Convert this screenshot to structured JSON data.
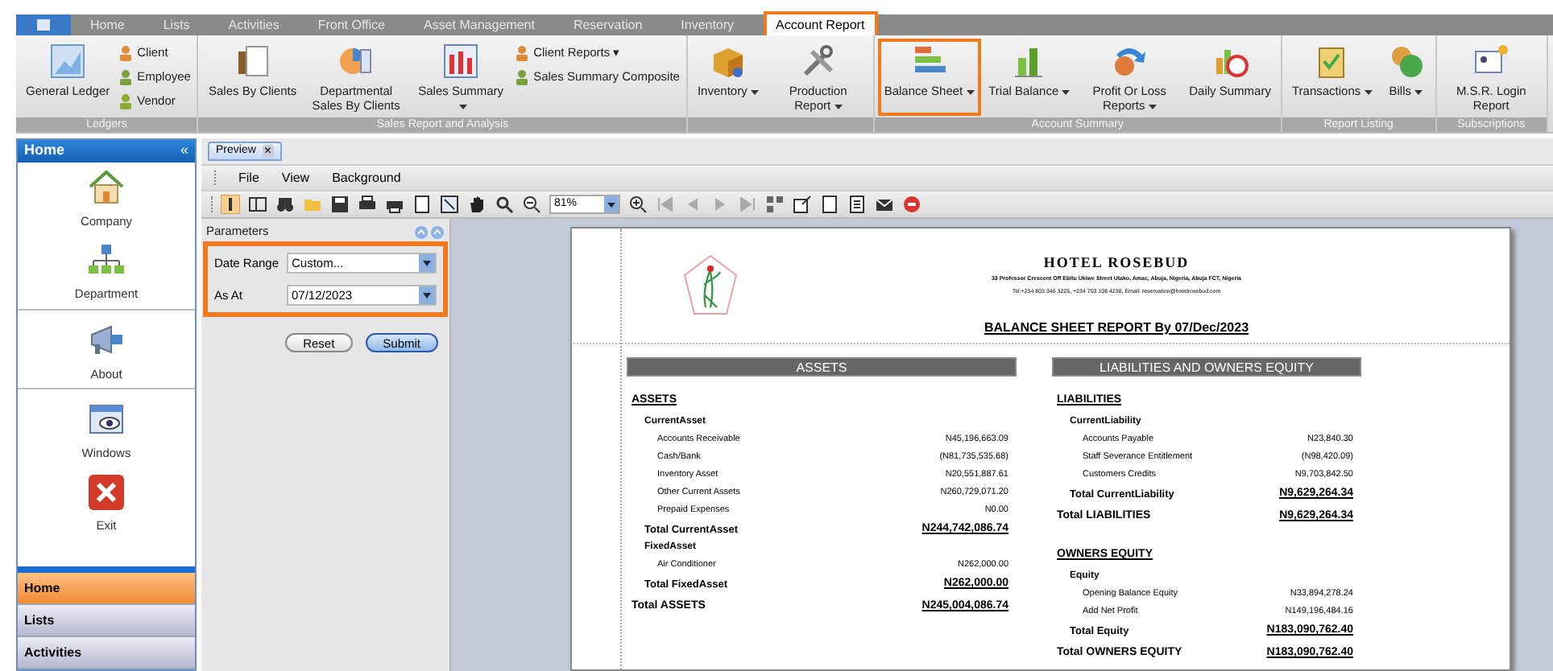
{
  "menu_tabs": [
    {
      "label": "Home",
      "selected": false
    },
    {
      "label": "Lists",
      "selected": false
    },
    {
      "label": "Activities",
      "selected": false
    },
    {
      "label": "Front Office",
      "selected": false
    },
    {
      "label": "Asset Management",
      "selected": false
    },
    {
      "label": "Reservation",
      "selected": false
    },
    {
      "label": "Inventory",
      "selected": false
    },
    {
      "label": "Account Report",
      "selected": true
    }
  ],
  "ribbon_groups": [
    {
      "label": "Ledgers",
      "buttons": [
        {
          "kind": "large",
          "label": "General Ledger",
          "has_menu": false,
          "highlighted": false
        },
        {
          "kind": "stack",
          "items": [
            "Client",
            "Employee",
            "Vendor"
          ]
        }
      ]
    },
    {
      "label": "Sales Report and Analysis",
      "buttons": [
        {
          "kind": "large",
          "label": "Sales By Clients",
          "has_menu": false,
          "highlighted": false
        },
        {
          "kind": "large",
          "label": "Departmental Sales By Clients",
          "has_menu": false,
          "highlighted": false
        },
        {
          "kind": "large",
          "label": "Sales Summary",
          "has_menu": true,
          "highlighted": false
        },
        {
          "kind": "stack",
          "items": [
            "Client Reports ▾",
            "Sales Summary Composite"
          ]
        }
      ]
    },
    {
      "buttons": [
        {
          "kind": "large",
          "label": "Inventory",
          "has_menu": true,
          "highlighted": false
        },
        {
          "kind": "large",
          "label": "Production Report",
          "has_menu": true,
          "highlighted": false
        }
      ]
    },
    {
      "label": "Account Summary",
      "buttons": [
        {
          "kind": "large",
          "label": "Balance Sheet",
          "has_menu": true,
          "highlighted": true
        },
        {
          "kind": "large",
          "label": "Trial Balance",
          "has_menu": true,
          "highlighted": false
        },
        {
          "kind": "large",
          "label": "Profit Or Loss Reports",
          "has_menu": true,
          "highlighted": false
        },
        {
          "kind": "large",
          "label": "Daily Summary",
          "has_menu": false,
          "highlighted": false
        }
      ]
    },
    {
      "label": "Report Listing",
      "buttons": [
        {
          "kind": "large",
          "label": "Transactions",
          "has_menu": true,
          "highlighted": false
        },
        {
          "kind": "large",
          "label": "Bills",
          "has_menu": true,
          "highlighted": false
        }
      ]
    },
    {
      "label": "Subscriptions",
      "buttons": [
        {
          "kind": "large",
          "label": "M.S.R. Login Report",
          "has_menu": false,
          "highlighted": false
        }
      ]
    }
  ],
  "sidebar": {
    "title": "Home",
    "collapse": "«",
    "items": [
      "Company",
      "Department",
      "About",
      "Windows",
      "Exit"
    ],
    "nav": [
      {
        "label": "Home",
        "selected": true
      },
      {
        "label": "Lists",
        "selected": false
      },
      {
        "label": "Activities",
        "selected": false
      }
    ]
  },
  "document_tab": {
    "label": "Preview",
    "close": "×"
  },
  "menu": [
    "File",
    "View",
    "Background"
  ],
  "zoom": "81%",
  "parameters": {
    "title": "Parameters",
    "highlighted": true,
    "fields": [
      {
        "label": "Date Range",
        "value": "Custom..."
      },
      {
        "label": "As At",
        "value": "07/12/2023"
      }
    ],
    "buttons": [
      {
        "label": "Reset",
        "primary": false
      },
      {
        "label": "Submit",
        "primary": true
      }
    ]
  },
  "report": {
    "hotel_name": "HOTEL ROSEBUD",
    "address": "33 Professor Crescent Off Ebitu Ukiwe Street Utako, Amac, Abuja, Nigeria, Abuja FCT, Nigeria",
    "contact": "Tel:+234 803 346 3225, +234 703 108 4238, Email: reservation@hotelrosebud.com",
    "title": "BALANCE SHEET REPORT By 07/Dec/2023",
    "columns": [
      {
        "header": "ASSETS",
        "blocks": [
          {
            "title": "ASSETS",
            "groups": [
              {
                "name": "CurrentAsset",
                "items": [
                  {
                    "label": "Accounts Receivable",
                    "value": "N45,196,663.09"
                  },
                  {
                    "label": "Cash/Bank",
                    "value": "(N81,735,535.68)"
                  },
                  {
                    "label": "Inventory Asset",
                    "value": "N20,551,887.61"
                  },
                  {
                    "label": "Other Current Assets",
                    "value": "N260,729,071.20"
                  },
                  {
                    "label": "Prepaid Expenses",
                    "value": "N0.00"
                  }
                ],
                "total": {
                  "label": "Total CurrentAsset",
                  "value": "N244,742,086.74"
                }
              },
              {
                "name": "FixedAsset",
                "items": [
                  {
                    "label": "Air Conditioner",
                    "value": "N262,000.00"
                  }
                ],
                "total": {
                  "label": "Total FixedAsset",
                  "value": "N262,000.00"
                }
              }
            ],
            "total": {
              "label": "Total ASSETS",
              "value": "N245,004,086.74"
            }
          }
        ]
      },
      {
        "header": "LIABILITIES AND OWNERS EQUITY",
        "blocks": [
          {
            "title": "LIABILITIES",
            "groups": [
              {
                "name": "CurrentLiability",
                "items": [
                  {
                    "label": "Accounts Payable",
                    "value": "N23,840.30"
                  },
                  {
                    "label": "Staff Severance Entitlement",
                    "value": "(N98,420.09)"
                  },
                  {
                    "label": "Customers Credits",
                    "value": "N9,703,842.50"
                  }
                ],
                "total": {
                  "label": "Total CurrentLiability",
                  "value": "N9,629,264.34"
                }
              }
            ],
            "total": {
              "label": "Total LIABILITIES",
              "value": "N9,629,264.34"
            }
          },
          {
            "title": "OWNERS EQUITY",
            "groups": [
              {
                "name": "Equity",
                "items": [
                  {
                    "label": "Opening Balance Equity",
                    "value": "N33,894,278.24"
                  },
                  {
                    "label": "Add Net Profit",
                    "value": "N149,196,484.16"
                  }
                ],
                "total": {
                  "label": "Total Equity",
                  "value": "N183,090,762.40"
                }
              }
            ],
            "total": {
              "label": "Total OWNERS EQUITY",
              "value": "N183,090,762.40"
            }
          }
        ]
      }
    ]
  }
}
